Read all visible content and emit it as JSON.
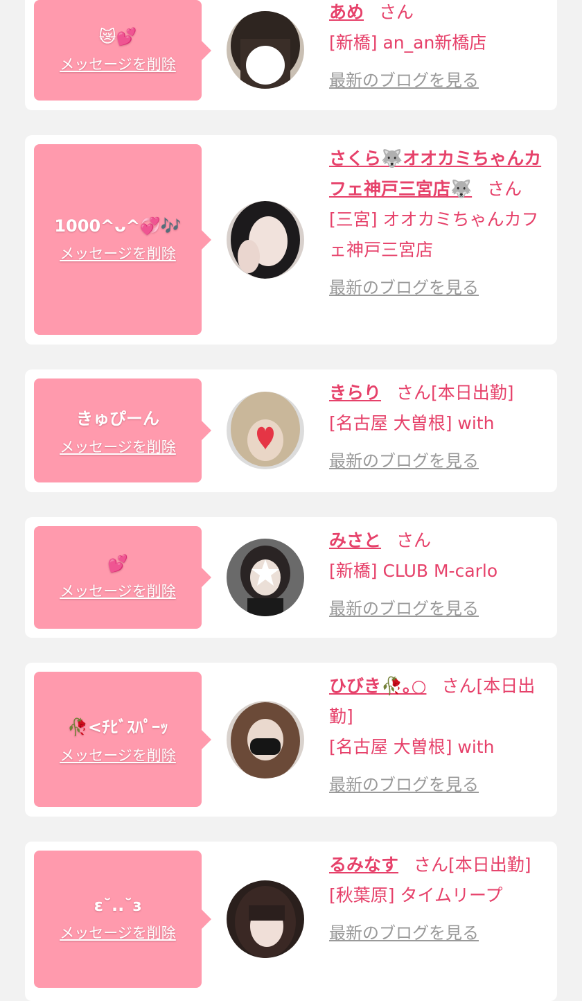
{
  "colors": {
    "accent_pink": "#e6416a",
    "bubble_pink": "#ff9aad",
    "background": "#f2f2f2",
    "link_gray": "#999999"
  },
  "delete_label": "メッセージを削除",
  "blog_label": "最新のブログを見る",
  "san_label": "さん",
  "cards": [
    {
      "message": "😿💕",
      "name": "あめ",
      "status": "",
      "shop": "[新橋] an_an新橋店",
      "avatar": "blunt-bangs-face-hidden"
    },
    {
      "message": "1000^ᴗ^💞🎶",
      "name": "さくら🐺オオカミちゃんカフェ神戸三宮店🐺",
      "status": "",
      "shop": "[三宮] オオカミちゃんカフェ神戸三宮店",
      "avatar": "dark-hair-hand-on-face"
    },
    {
      "message": "きゅぴーん",
      "name": "きらり",
      "status": "[本日出勤]",
      "shop": "[名古屋 大曽根] with",
      "avatar": "blonde-heart-sticker"
    },
    {
      "message": "💕",
      "name": "みさと",
      "status": "",
      "shop": "[新橋] CLUB M-carlo",
      "avatar": "twin-tails-star-sticker"
    },
    {
      "message": "🥀<ﾁﾋﾞｽﾊﾟｰｯ",
      "name": "ひびき🥀｡○",
      "status": "[本日出勤]",
      "shop": "[名古屋 大曽根] with",
      "avatar": "black-mask-brown-hair"
    },
    {
      "message": "ɛ˘..˘ɜ",
      "name": "るみなす",
      "status": "[本日出勤]",
      "shop": "[秋葉原] タイムリープ",
      "avatar": "bangs-peace-sign"
    }
  ]
}
